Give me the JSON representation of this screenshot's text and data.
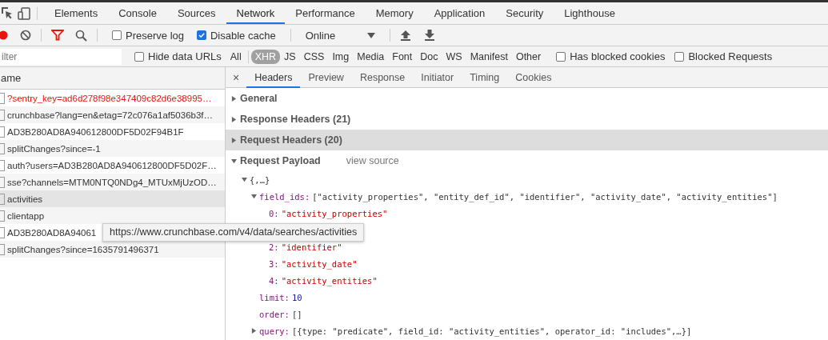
{
  "main_tabs": [
    {
      "label": "Elements",
      "selected": false
    },
    {
      "label": "Console",
      "selected": false
    },
    {
      "label": "Sources",
      "selected": false
    },
    {
      "label": "Network",
      "selected": true
    },
    {
      "label": "Performance",
      "selected": false
    },
    {
      "label": "Memory",
      "selected": false
    },
    {
      "label": "Application",
      "selected": false
    },
    {
      "label": "Security",
      "selected": false
    },
    {
      "label": "Lighthouse",
      "selected": false
    }
  ],
  "toolbar": {
    "preserve_log": {
      "label": "Preserve log",
      "checked": false
    },
    "disable_cache": {
      "label": "Disable cache",
      "checked": true
    },
    "throttling": "Online"
  },
  "filter_bar": {
    "placeholder": "ilter",
    "hide_data_urls": {
      "label": "Hide data URLs",
      "checked": false
    },
    "types": [
      {
        "label": "All",
        "selected": false
      },
      {
        "label": "XHR",
        "selected": true
      },
      {
        "label": "JS",
        "selected": false
      },
      {
        "label": "CSS",
        "selected": false
      },
      {
        "label": "Img",
        "selected": false
      },
      {
        "label": "Media",
        "selected": false
      },
      {
        "label": "Font",
        "selected": false
      },
      {
        "label": "Doc",
        "selected": false
      },
      {
        "label": "WS",
        "selected": false
      },
      {
        "label": "Manifest",
        "selected": false
      },
      {
        "label": "Other",
        "selected": false
      }
    ],
    "has_blocked_cookies": {
      "label": "Has blocked cookies",
      "checked": false
    },
    "blocked_requests": {
      "label": "Blocked Requests",
      "checked": false
    }
  },
  "requests": {
    "column": "ame",
    "rows": [
      {
        "name": "?sentry_key=ad6d278f98e347409c82d6e38995…",
        "error": true,
        "selected": false
      },
      {
        "name": "crunchbase?lang=en&etag=72c076a1af5036b3f…",
        "error": false,
        "selected": false
      },
      {
        "name": "AD3B280AD8A940612800DF5D02F94B1F",
        "error": false,
        "selected": false
      },
      {
        "name": "splitChanges?since=-1",
        "error": false,
        "selected": false
      },
      {
        "name": "auth?users=AD3B280AD8A940612800DF5D02F…",
        "error": false,
        "selected": false
      },
      {
        "name": "sse?channels=MTM0NTQ0NDg4_MTUxMjUzOD…",
        "error": false,
        "selected": false
      },
      {
        "name": "activities",
        "error": false,
        "selected": true
      },
      {
        "name": "clientapp",
        "error": false,
        "selected": false
      },
      {
        "name": "AD3B280AD8A94061",
        "error": false,
        "selected": false
      },
      {
        "name": "splitChanges?since=1635791496371",
        "error": false,
        "selected": false
      }
    ]
  },
  "tooltip": "https://www.crunchbase.com/v4/data/searches/activities",
  "close": "×",
  "detail_tabs": [
    {
      "label": "Headers",
      "selected": true
    },
    {
      "label": "Preview",
      "selected": false
    },
    {
      "label": "Response",
      "selected": false
    },
    {
      "label": "Initiator",
      "selected": false
    },
    {
      "label": "Timing",
      "selected": false
    },
    {
      "label": "Cookies",
      "selected": false
    }
  ],
  "sections": [
    {
      "title": "General",
      "expanded": false,
      "selected": false
    },
    {
      "title": "Response Headers (21)",
      "expanded": false,
      "selected": false
    },
    {
      "title": "Request Headers (20)",
      "expanded": false,
      "selected": true
    },
    {
      "title": "Request Payload",
      "expanded": true,
      "selected": false,
      "link": "view source"
    }
  ],
  "payload": {
    "value": "{,…}",
    "kind": "object",
    "expanded": true,
    "children": [
      {
        "key": "field_ids:",
        "value": "[\"activity_properties\", \"entity_def_id\", \"identifier\", \"activity_date\", \"activity_entities\"]",
        "kind": "object",
        "expanded": true,
        "children": [
          {
            "key": "0:",
            "value": "\"activity_properties\"",
            "kind": "string"
          },
          {
            "kind": "covered"
          },
          {
            "key": "2:",
            "value": "\"identifier\"",
            "kind": "string"
          },
          {
            "key": "3:",
            "value": "\"activity_date\"",
            "kind": "string"
          },
          {
            "key": "4:",
            "value": "\"activity_entities\"",
            "kind": "string"
          }
        ]
      },
      {
        "key": "limit:",
        "value": "10",
        "kind": "number"
      },
      {
        "key": "order:",
        "value": "[]",
        "kind": "object"
      },
      {
        "key": "query:",
        "value": "[{type: \"predicate\", field_id: \"activity_entities\", operator_id: \"includes\",…}]",
        "kind": "object",
        "expanded": false
      }
    ]
  }
}
